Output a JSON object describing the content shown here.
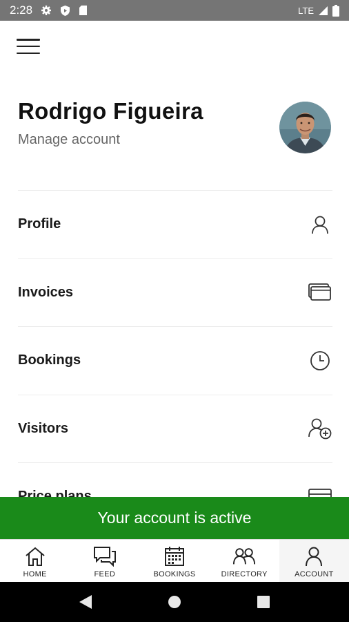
{
  "status_bar": {
    "time": "2:28",
    "network": "LTE",
    "left_icons": [
      "settings-icon",
      "shield-icon",
      "sd-card-icon"
    ],
    "right_icons": [
      "signal-icon",
      "battery-icon"
    ]
  },
  "header": {
    "menu_icon": "hamburger-menu-icon",
    "user_name": "Rodrigo Figueira",
    "manage_label": "Manage account",
    "avatar": "profile-photo"
  },
  "menu": {
    "items": [
      {
        "label": "Profile",
        "icon": "person-icon"
      },
      {
        "label": "Invoices",
        "icon": "cards-icon"
      },
      {
        "label": "Bookings",
        "icon": "clock-icon"
      },
      {
        "label": "Visitors",
        "icon": "add-person-icon"
      },
      {
        "label": "Price plans",
        "icon": "card-icon"
      }
    ]
  },
  "banner": {
    "text": "Your account is active",
    "color": "#1a8a1a"
  },
  "bottom_nav": {
    "items": [
      {
        "label": "HOME",
        "icon": "home-icon"
      },
      {
        "label": "FEED",
        "icon": "chat-icon"
      },
      {
        "label": "BOOKINGS",
        "icon": "calendar-icon"
      },
      {
        "label": "DIRECTORY",
        "icon": "people-icon"
      },
      {
        "label": "ACCOUNT",
        "icon": "person-icon"
      }
    ],
    "active": "ACCOUNT"
  },
  "system_nav": [
    "back-icon",
    "home-circle-icon",
    "recents-icon"
  ]
}
